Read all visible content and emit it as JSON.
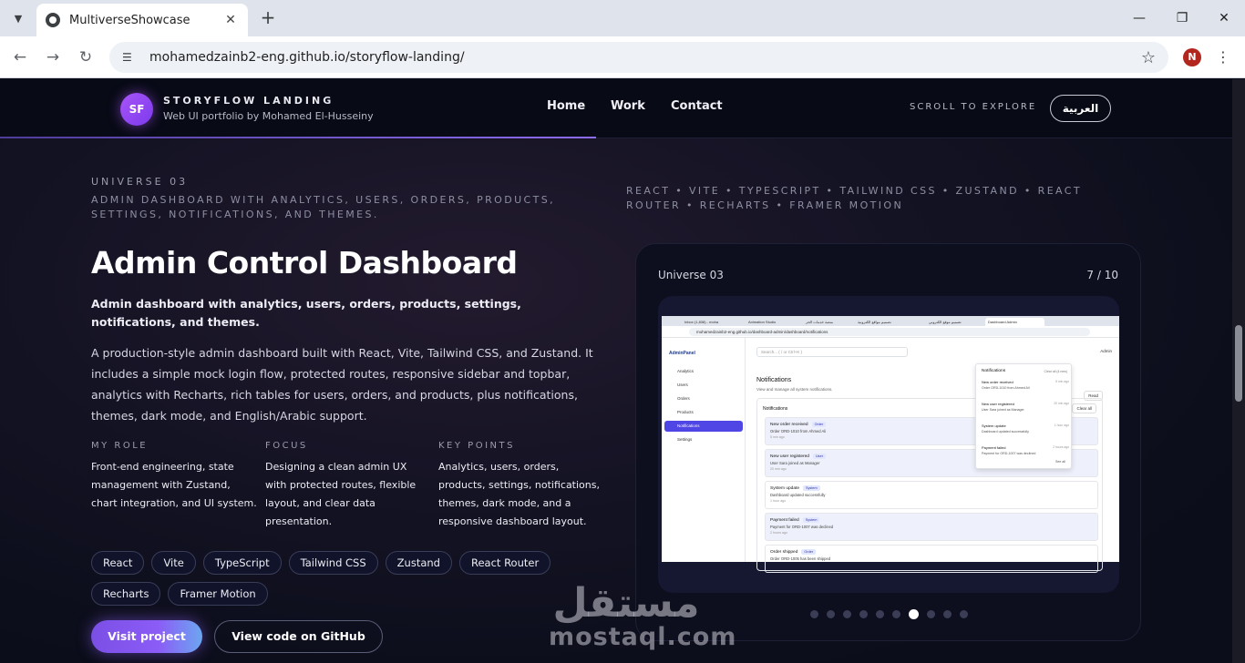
{
  "browser": {
    "tab_title": "MultiverseShowcase",
    "url": "mohamedzainb2-eng.github.io/storyflow-landing/",
    "profile_initial": "N"
  },
  "header": {
    "logo": "SF",
    "brand_name": "STORYFLOW LANDING",
    "brand_sub": "Web UI portfolio by Mohamed El-Husseiny",
    "nav": [
      "Home",
      "Work",
      "Contact"
    ],
    "scroll_hint": "SCROLL TO EXPLORE",
    "lang_button": "العربية"
  },
  "project": {
    "universe": "UNIVERSE 03",
    "eyebrow": "ADMIN DASHBOARD WITH ANALYTICS, USERS, ORDERS, PRODUCTS, SETTINGS, NOTIFICATIONS, AND THEMES.",
    "tech_line": "REACT • VITE • TYPESCRIPT • TAILWIND CSS • ZUSTAND • REACT ROUTER • RECHARTS • FRAMER MOTION",
    "title": "Admin Control Dashboard",
    "tagline": "Admin dashboard with analytics, users, orders, products, settings, notifications, and themes.",
    "description": "A production-style admin dashboard built with React, Vite, Tailwind CSS, and Zustand. It includes a simple mock login flow, protected routes, responsive sidebar and topbar, analytics with Recharts, rich tables for users, orders, and products, plus notifications, themes, dark mode, and English/Arabic support.",
    "role_head": "MY ROLE",
    "role_body": "Front-end engineering, state management with Zustand, chart integration, and UI system.",
    "focus_head": "FOCUS",
    "focus_body": "Designing a clean admin UX with protected routes, flexible layout, and clear data presentation.",
    "points_head": "KEY POINTS",
    "points_body": "Analytics, users, orders, products, settings, notifications, themes, dark mode, and a responsive dashboard layout.",
    "chips": [
      "React",
      "Vite",
      "TypeScript",
      "Tailwind CSS",
      "Zustand",
      "React Router",
      "Recharts",
      "Framer Motion"
    ],
    "visit_button": "Visit project",
    "github_button": "View code on GitHub"
  },
  "card": {
    "label": "Universe 03",
    "counter": "7 / 10",
    "dots_total": 10,
    "dots_active_index": 6
  },
  "mini": {
    "tabs": [
      "Inbox (1,838) - moha",
      "Animation Studio",
      "منصة خدمات الحر",
      "تصميم مواقع الكترونية",
      "تصميم موقع الكتروني",
      "Dashboard Admin"
    ],
    "url": "mohamedzainb2-eng.github.io/dashboard-admin/dashboard/notifications",
    "brand": "AdminPanel",
    "side_items": [
      "Analytics",
      "Users",
      "Orders",
      "Products",
      "Notifications",
      "Settings"
    ],
    "search": "Search... ( / or Ctrl+K )",
    "admin": "Admin",
    "heading": "Notifications",
    "subheading": "View and manage all system notifications.",
    "panel_title": "Notifications",
    "clear_all": "Clear all",
    "read": "Read",
    "notifications": [
      {
        "title": "New order received",
        "tag": "Order",
        "body": "Order ORD-1010 from Ahmed Ali",
        "time": "5 min ago"
      },
      {
        "title": "New user registered",
        "tag": "User",
        "body": "User Sara joined as Manager",
        "time": "20 min ago"
      },
      {
        "title": "System update",
        "tag": "System",
        "body": "Dashboard updated successfully",
        "time": "1 hour ago"
      },
      {
        "title": "Payment failed",
        "tag": "System",
        "body": "Payment for ORD-1007 was declined",
        "time": "2 hours ago"
      },
      {
        "title": "Order shipped",
        "tag": "Order",
        "body": "Order ORD-1005 has been shipped",
        "time": ""
      }
    ],
    "popover": {
      "title": "Notifications",
      "mark": "Clear all (4 new)",
      "see_all": "See all",
      "items": [
        {
          "title": "New order received",
          "body": "Order ORD-1010 from Ahmed Ali",
          "time": "5 min ago"
        },
        {
          "title": "New user registered",
          "body": "User Sara joined as Manager",
          "time": "20 min ago"
        },
        {
          "title": "System update",
          "body": "Dashboard updated successfully",
          "time": "1 hour ago"
        },
        {
          "title": "Payment failed",
          "body": "Payment for ORD-1007 was declined",
          "time": "2 hours ago"
        }
      ]
    }
  },
  "watermark": {
    "arabic": "مستقل",
    "latin": "mostaql.com"
  }
}
